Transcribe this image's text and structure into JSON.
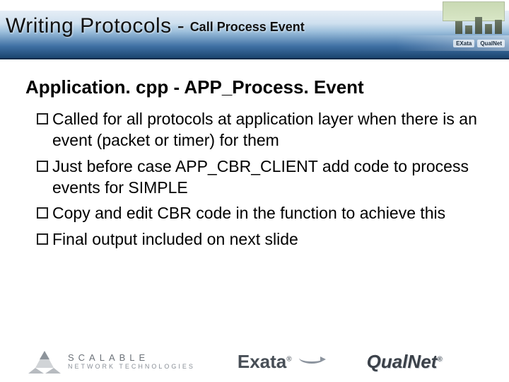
{
  "header": {
    "title_main": "Writing Protocols",
    "title_sep": "-",
    "title_sub": "Call Process Event",
    "corner_tag_1": "EXata",
    "corner_tag_2": "QualNet"
  },
  "content": {
    "heading": "Application. cpp - APP_Process. Event",
    "bullets": [
      "Called for all protocols at application layer when there is an event (packet or timer) for them",
      "Just before case APP_CBR_CLIENT add code to process events for SIMPLE",
      "Copy and edit CBR code in the function to achieve this",
      "Final output included on next slide"
    ]
  },
  "footer": {
    "scalable_line1": "SCALABLE",
    "scalable_line2": "NETWORK TECHNOLOGIES",
    "exata_text": "Exata",
    "qualnet_text": "QualNet",
    "registered": "®"
  }
}
